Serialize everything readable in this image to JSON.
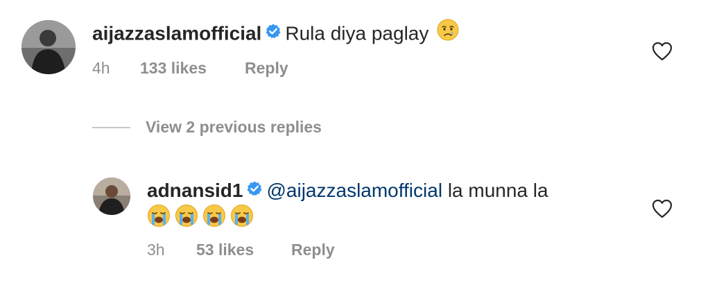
{
  "comments": [
    {
      "username": "aijazzaslamofficial",
      "verified": true,
      "text": "Rula diya paglay",
      "emoji": "crying-face",
      "time": "4h",
      "likes": "133 likes",
      "reply_label": "Reply"
    },
    {
      "username": "adnansid1",
      "verified": true,
      "mention": "@aijazzaslamofficial",
      "text": "la munna la",
      "emojis": [
        "loudly-crying-face",
        "loudly-crying-face",
        "loudly-crying-face",
        "loudly-crying-face"
      ],
      "time": "3h",
      "likes": "53 likes",
      "reply_label": "Reply"
    }
  ],
  "view_replies": {
    "label": "View 2 previous replies"
  },
  "colors": {
    "text": "#262626",
    "secondary": "#8e8e8e",
    "mention": "#00376b",
    "verified": "#3897f0"
  }
}
